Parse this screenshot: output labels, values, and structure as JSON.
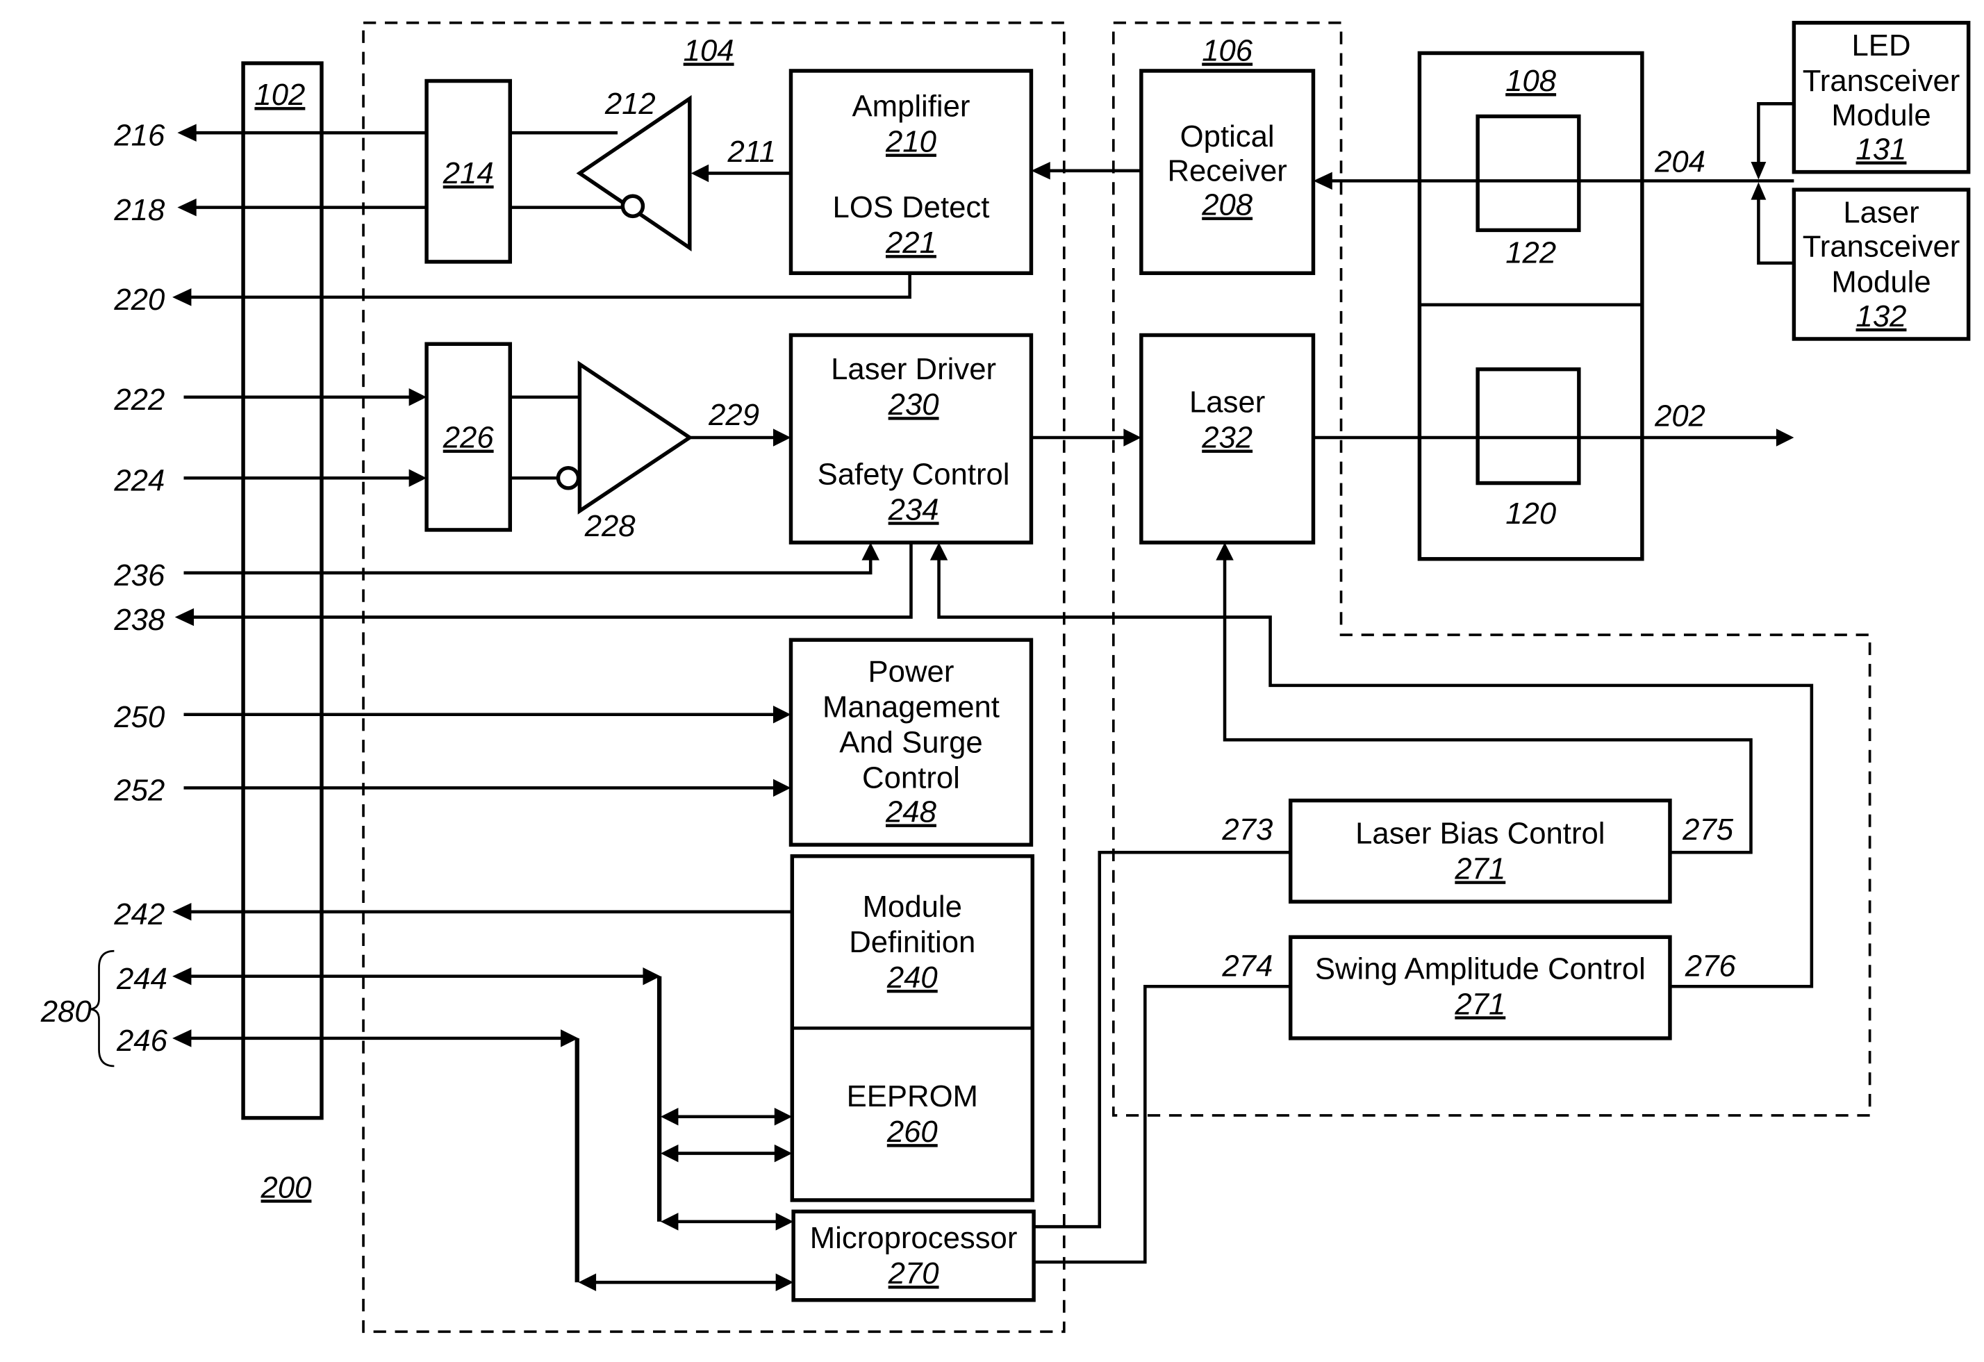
{
  "figure_label": "200",
  "groups": {
    "bus": "102",
    "ic": "104",
    "tosa_rosa": "106",
    "port": "108"
  },
  "blocks": {
    "b214": {
      "ref": "214"
    },
    "b226": {
      "ref": "226"
    },
    "amplifier": {
      "title": "Amplifier",
      "ref": "210",
      "title2": "LOS Detect",
      "ref2": "221"
    },
    "laser_driver": {
      "title": "Laser Driver",
      "ref": "230",
      "title2": "Safety Control",
      "ref2": "234"
    },
    "power": {
      "lines": [
        "Power",
        "Management",
        "And Surge",
        "Control"
      ],
      "ref": "248"
    },
    "module_def": {
      "lines": [
        "Module",
        "Definition"
      ],
      "ref": "240"
    },
    "eeprom": {
      "title": "EEPROM",
      "ref": "260"
    },
    "micro": {
      "title": "Microprocessor",
      "ref": "270"
    },
    "optical_receiver": {
      "lines": [
        "Optical",
        "Receiver"
      ],
      "ref": "208"
    },
    "laser": {
      "title": "Laser",
      "ref": "232"
    },
    "laser_bias": {
      "title": "Laser Bias Control",
      "ref": "271"
    },
    "swing": {
      "title": "Swing Amplitude Control",
      "ref": "271"
    },
    "led_module": {
      "lines": [
        "LED",
        "Transceiver",
        "Module"
      ],
      "ref": "131"
    },
    "laser_module": {
      "lines": [
        "Laser",
        "Transceiver",
        "Module"
      ],
      "ref": "132"
    },
    "sub122": {
      "ref": "122"
    },
    "sub120": {
      "ref": "120"
    }
  },
  "signals": {
    "s216": "216",
    "s218": "218",
    "s220": "220",
    "s222": "222",
    "s224": "224",
    "s236": "236",
    "s238": "238",
    "s250": "250",
    "s252": "252",
    "s242": "242",
    "s244": "244",
    "s246": "246",
    "s280": "280",
    "s211": "211",
    "s212": "212",
    "s228": "228",
    "s229": "229",
    "s202": "202",
    "s204": "204",
    "s273": "273",
    "s274": "274",
    "s275": "275",
    "s276": "276"
  }
}
